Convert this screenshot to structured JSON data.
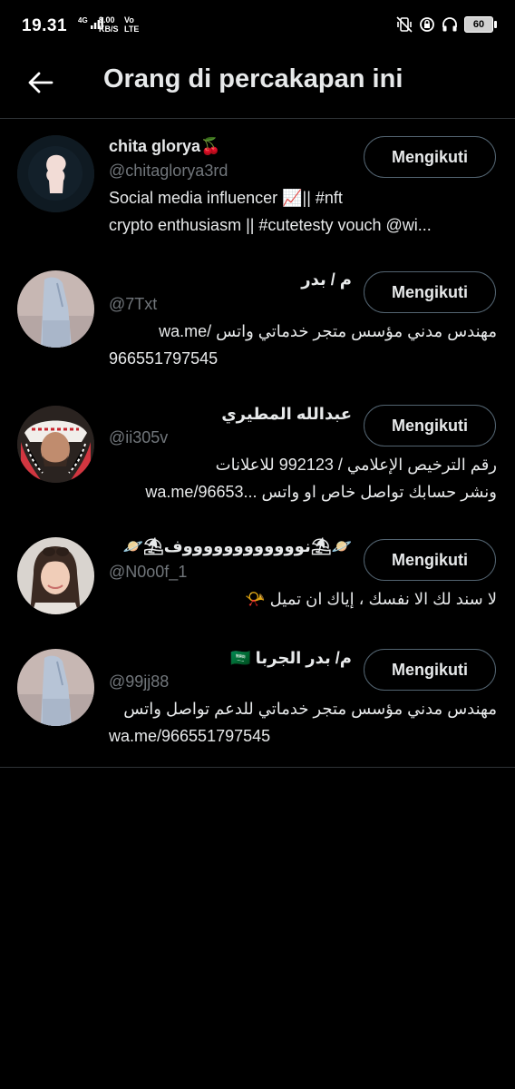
{
  "status_bar": {
    "time": "19.31",
    "network": "4G",
    "speed": "9.00",
    "speed_unit": "KB/S",
    "volte": "Vo",
    "lte": "LTE",
    "battery": "60"
  },
  "header": {
    "title": "Orang di percakapan ini"
  },
  "users": [
    {
      "name": "chita glorya🍒",
      "handle": "@chitaglorya3rd",
      "bio_lines": [
        "Social media influencer 📈|| #nft",
        "crypto enthusiasm || #cutetesty vouch @wi..."
      ],
      "follow_label": "Mengikuti"
    },
    {
      "name": "م / بدر",
      "handle": "@7Txt",
      "bio_lines": [
        "مهندس مدني مؤسس متجر خدماتي واتس /wa.me",
        "966551797545"
      ],
      "follow_label": "Mengikuti"
    },
    {
      "name": "عبدالله المطيري",
      "handle": "@ii305v",
      "bio_lines": [
        "رقم الترخيص الإعلامي / 992123 للاعلانات",
        "ونشر حسابك تواصل خاص او واتس ...wa.me/96653"
      ],
      "follow_label": "Mengikuti"
    },
    {
      "name": "🪐⛱نووووووووووووف⛱🪐",
      "handle": "@N0o0f_1",
      "bio_lines": [
        "لا سند لك الا نفسك ، إياك ان تميل 📯"
      ],
      "follow_label": "Mengikuti"
    },
    {
      "name": "م/ بدر الجربا 🇸🇦",
      "handle": "@99jj88",
      "bio_lines": [
        "مهندس مدني مؤسس متجر خدماتي للدعم تواصل واتس",
        "wa.me/966551797545"
      ],
      "follow_label": "Mengikuti"
    }
  ],
  "colors": {
    "background": "#000000",
    "text_primary": "#e7e9ea",
    "text_secondary": "#71767b",
    "border": "#2f3336",
    "button_border": "#536471"
  }
}
